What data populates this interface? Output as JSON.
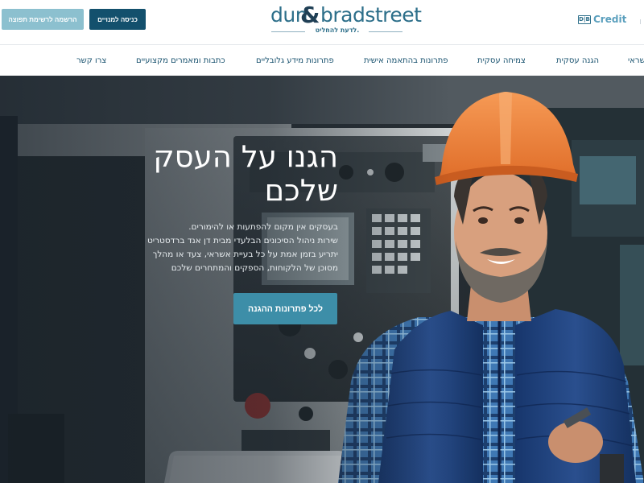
{
  "header": {
    "register_button": "הרשמה לרשימת תפוצה",
    "members_button": "כניסה למנויים",
    "logo": {
      "word_left": "dun",
      "ampersand": "&",
      "word_right": "bradstreet",
      "tagline": "לדעת להחליט."
    },
    "credit_brand": {
      "mark": "D|B",
      "text": "Credit"
    }
  },
  "nav": {
    "items": [
      "צרו קשר",
      "כתבות ומאמרים מקצועיים",
      "פתרונות מידע גלובליים",
      "פתרונות בהתאמה אישית",
      "צמיחה עסקית",
      "הגנה עסקית",
      "אשראי"
    ]
  },
  "hero": {
    "title_line1": "הגנו על העסק",
    "title_line2": "שלכם",
    "body_line1": "בעסקים אין מקום להפתעות או להימורים.",
    "body_line2": "שירות ניהול הסיכונים הבלעדי מבית דן אנד ברדסטריט",
    "body_line3": "יתריע בזמן אמת על כל בעיית אשראי, צעד או מהלך",
    "body_line4": "מסוכן של הלקוחות, הספקים והמתחרים שלכם",
    "cta": "לכל פתרונות ההגנה"
  },
  "colors": {
    "brand_dark": "#13506d",
    "brand_light": "#8cc0cf",
    "cta": "#3d8ea8",
    "helmet": "#f0843f",
    "vest": "#1e3f78"
  }
}
